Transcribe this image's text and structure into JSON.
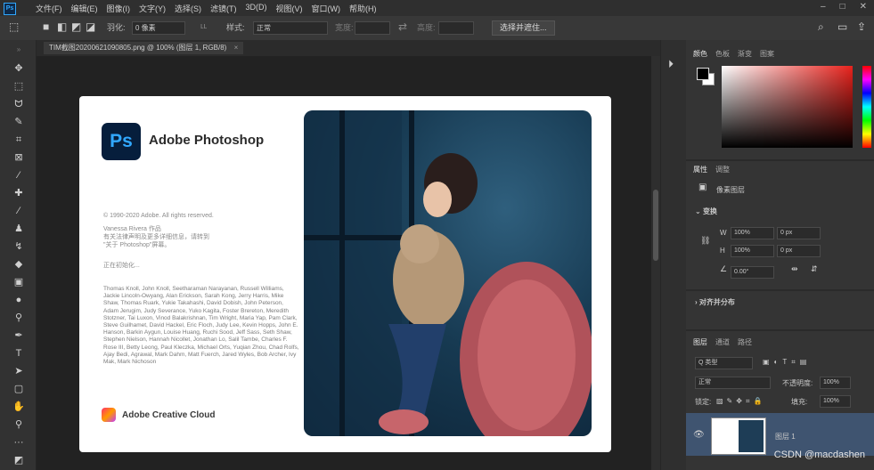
{
  "menubar": {
    "logo": "Ps",
    "items": [
      "文件(F)",
      "编辑(E)",
      "图像(I)",
      "文字(Y)",
      "选择(S)",
      "滤镜(T)",
      "3D(D)",
      "视图(V)",
      "窗口(W)",
      "帮助(H)"
    ],
    "win_min": "–",
    "win_max": "□",
    "win_close": "✕"
  },
  "options": {
    "feather_label": "羽化:",
    "feather_value": "0 像素",
    "style_label": "样式:",
    "style_value": "正常",
    "width_label": "宽度:",
    "height_label": "高度:",
    "mask_button": "选择并遮住..."
  },
  "document": {
    "tab_title": "TIM截图20200621090805.png @ 100% (图层 1, RGB/8)",
    "tab_close": "×"
  },
  "splash": {
    "logo": "Ps",
    "app_name": "Adobe Photoshop",
    "copyright": "© 1990-2020 Adobe. All rights reserved.",
    "version_lines": [
      "Vanessa Rivera 作品",
      "有关法律声明及更多详细信息，请转到",
      "\"关于 Photoshop\"屏幕。"
    ],
    "thanks": "正在初始化...",
    "credits": "Thomas Knoll, John Knoll, Seetharaman Narayanan, Russell Williams, Jackie Lincoln-Owyang, Alan Erickson, Sarah Kong, Jerry Harris, Mike Shaw, Thomas Ruark, Yukie Takahashi, David Dobish, John Peterson, Adam Jerugim, Judy Severance, Yuko Kagita, Foster Brereton, Meredith Stotzner, Tai Luxon, Vinod Balakrishnan, Tim Wright, Maria Yap, Pam Clark, Steve Guilhamet, David Hackel, Eric Floch, Judy Lee, Kevin Hopps, John E. Hanson, Barkin Aygun, Louise Huang, Ruchi Sood, Jeff Sass, Seth Shaw, Stephen Nielson, Hannah Nicollet, Jonathan Lo, Salil Tambe, Charles F. Rose III, Betty Leong, Paul Kleczka, Michael Orts, Yuqian Zhou, Chad Rolfs, Ajay Bedi, Agrawal, Mark Dahm, Matt Fuerch, Jared Wyles, Bob Archer, Ivy Mak, Mark Nichoson",
    "cc_text": "Adobe Creative Cloud"
  },
  "panels": {
    "color_tabs": [
      "颜色",
      "色板",
      "渐变",
      "图案"
    ],
    "prop_tabs": [
      "属性",
      "调整"
    ],
    "pixel_layer": "像素图层",
    "transform": "变换",
    "w_label": "W",
    "w_value": "100%",
    "h_label": "H",
    "h_value": "100%",
    "x_value": "0 px",
    "y_value": "0 px",
    "angle_value": "0.00°",
    "align": "对齐并分布",
    "layer_tabs": [
      "图层",
      "通道",
      "路径"
    ],
    "kind": "Q 类型",
    "blend": "正常",
    "opacity_label": "不透明度:",
    "opacity": "100%",
    "lock_label": "锁定:",
    "fill_label": "填充:",
    "fill": "100%",
    "layer_name": "图层 1"
  },
  "watermark": "CSDN @macdashen"
}
